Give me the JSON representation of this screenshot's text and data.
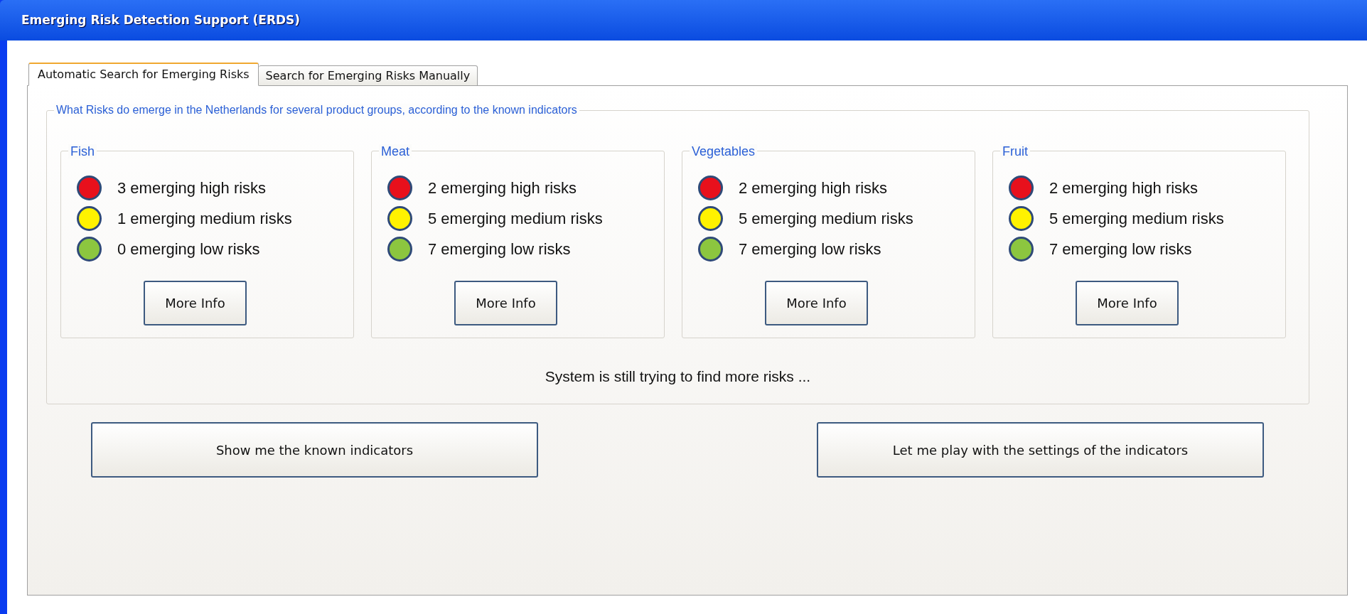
{
  "window": {
    "title": "Emerging Risk Detection Support (ERDS)"
  },
  "tabs": [
    {
      "label": "Automatic Search for Emerging Risks",
      "selected": true
    },
    {
      "label": "Search for Emerging Risks Manually",
      "selected": false
    }
  ],
  "overview": {
    "legend": "What Risks do emerge in the Netherlands for several product groups, according to the known indicators",
    "groups": [
      {
        "name": "Fish",
        "risks": [
          {
            "color": "#e8101c",
            "text": "3 emerging high risks"
          },
          {
            "color": "#fff200",
            "text": "1 emerging medium risks"
          },
          {
            "color": "#8cc63f",
            "text": "0 emerging low risks"
          }
        ],
        "button": "More Info"
      },
      {
        "name": "Meat",
        "risks": [
          {
            "color": "#e8101c",
            "text": "2 emerging high risks"
          },
          {
            "color": "#fff200",
            "text": "5 emerging medium risks"
          },
          {
            "color": "#8cc63f",
            "text": "7 emerging low risks"
          }
        ],
        "button": "More Info"
      },
      {
        "name": "Vegetables",
        "risks": [
          {
            "color": "#e8101c",
            "text": "2 emerging high risks"
          },
          {
            "color": "#fff200",
            "text": "5 emerging medium risks"
          },
          {
            "color": "#8cc63f",
            "text": "7 emerging low risks"
          }
        ],
        "button": "More Info"
      },
      {
        "name": "Fruit",
        "risks": [
          {
            "color": "#e8101c",
            "text": "2 emerging high risks"
          },
          {
            "color": "#fff200",
            "text": "5 emerging medium risks"
          },
          {
            "color": "#8cc63f",
            "text": "7 emerging low risks"
          }
        ],
        "button": "More Info"
      }
    ],
    "status": "System is still trying to find more risks ..."
  },
  "buttons": [
    "Show me the known indicators",
    "Let me play with the settings of the indicators"
  ]
}
